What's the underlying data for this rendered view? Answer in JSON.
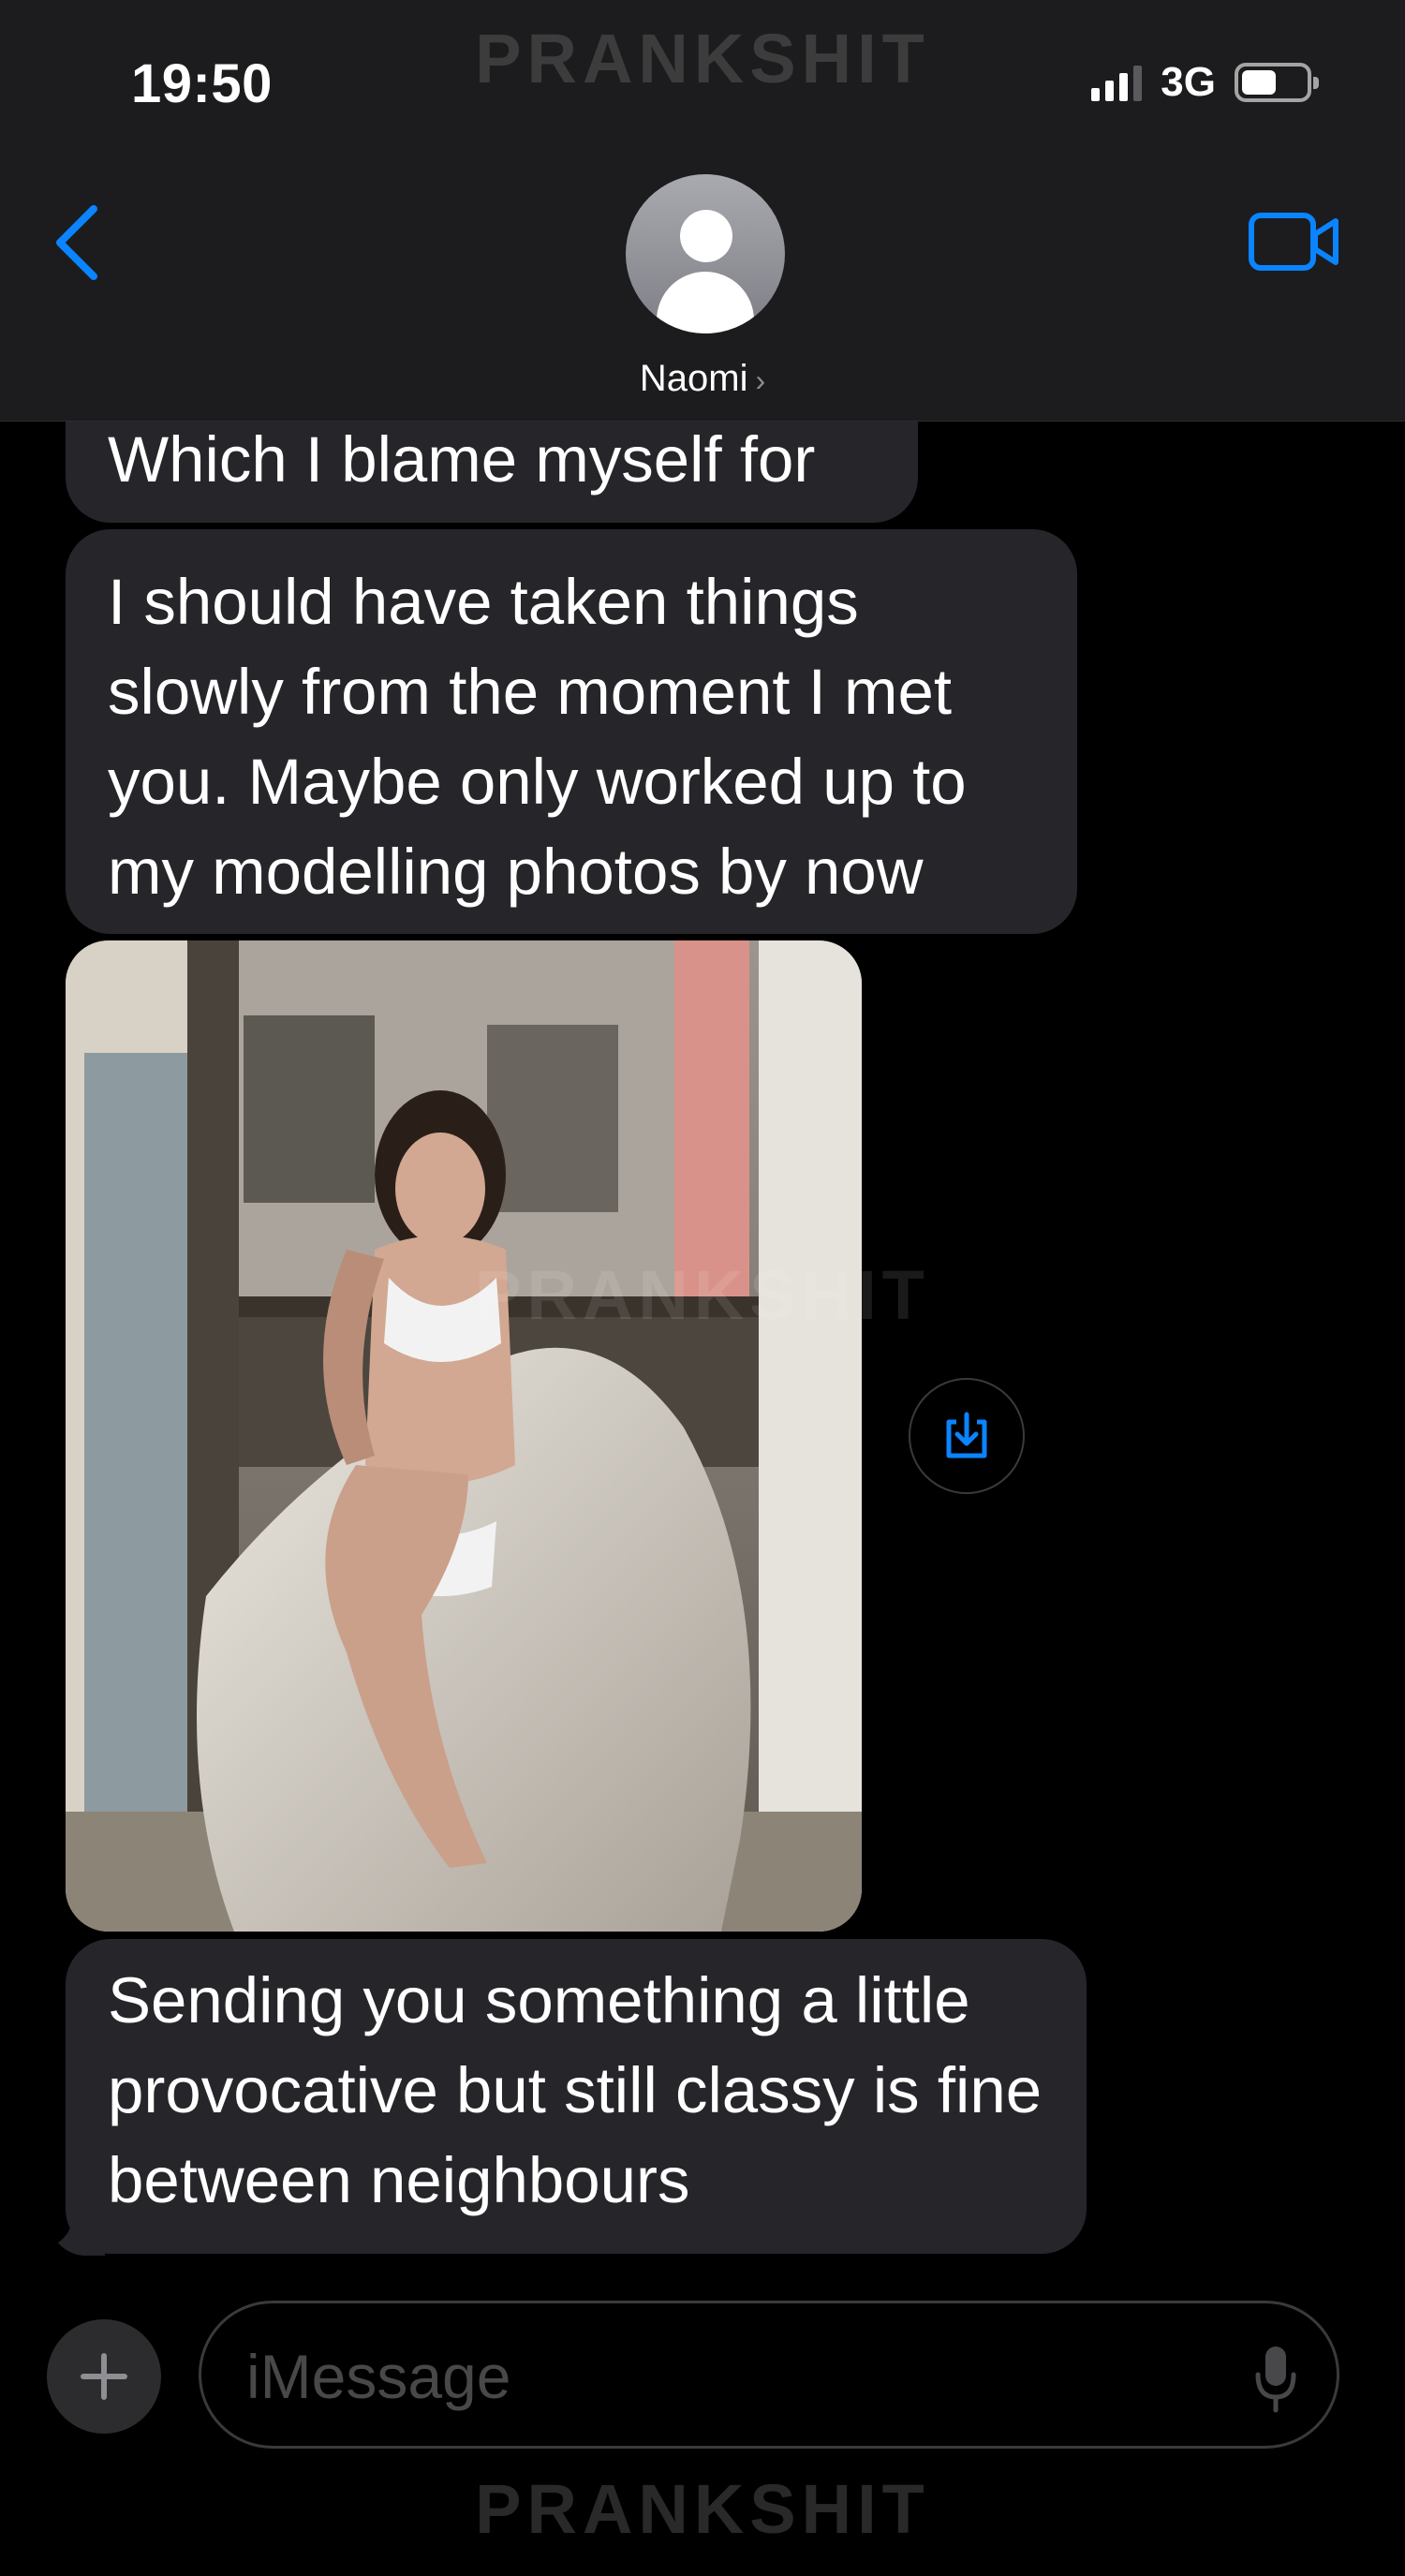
{
  "status_bar": {
    "time": "19:50",
    "network": "3G",
    "battery_level": 0.55
  },
  "watermark": {
    "text": "PRANKSHIT"
  },
  "header": {
    "contact_name": "Naomi",
    "back_icon": "chevron-left-icon",
    "video_icon": "video-camera-icon",
    "accent_color": "#0a84ff"
  },
  "messages": [
    {
      "type": "text",
      "text": "Which I blame myself for"
    },
    {
      "type": "text",
      "text": "I should have taken things slowly from the moment I met you. Maybe only worked up to my modelling photos by now"
    },
    {
      "type": "image",
      "save_icon": "save-to-device-icon"
    },
    {
      "type": "text",
      "text": "Sending you something a little provocative but still classy is fine between neighbours"
    }
  ],
  "composer": {
    "placeholder": "iMessage",
    "plus_icon": "plus-icon",
    "mic_icon": "microphone-icon"
  }
}
